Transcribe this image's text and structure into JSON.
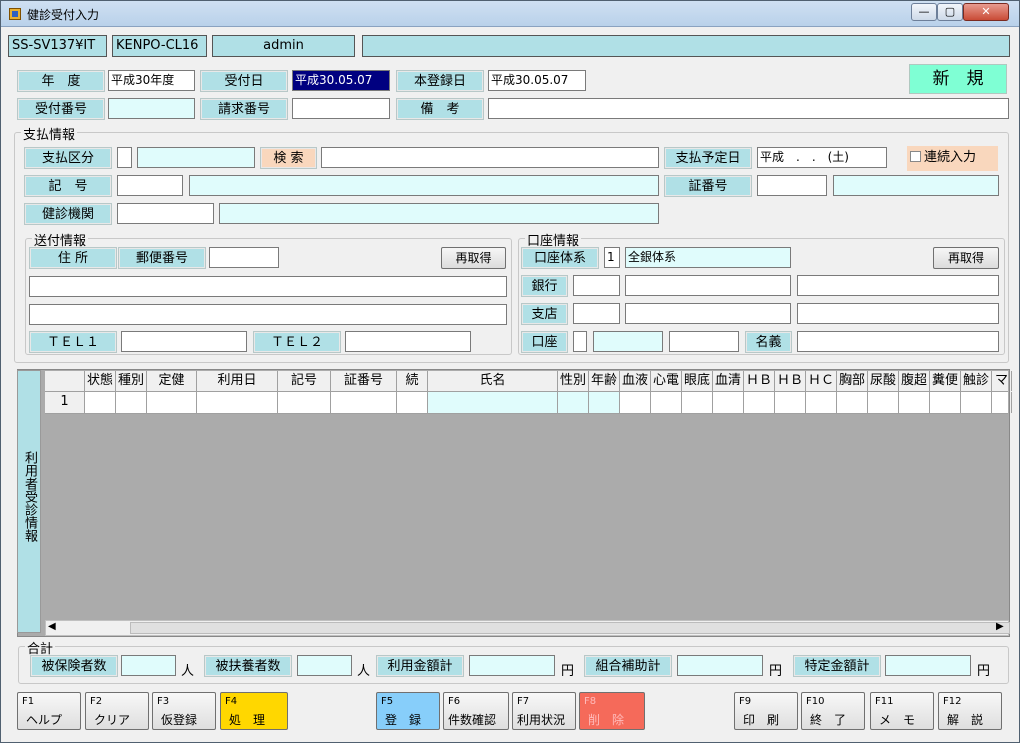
{
  "window": {
    "title": "健診受付入力",
    "min": "—",
    "max": "▢",
    "close": "✕"
  },
  "status": {
    "server": "SS-SV137¥IT",
    "client": "KENPO-CL16",
    "user": "admin"
  },
  "header": {
    "nendo_label": "年　度",
    "nendo_value": "平成30年度",
    "uketsukebi_label": "受付日",
    "uketsukebi_value": "平成30.05.07",
    "honnendo_label": "本登録日",
    "honnendo_value": "平成30.05.07",
    "new_label": "新　規",
    "uketsuke_no_label": "受付番号",
    "seikyu_no_label": "請求番号",
    "biko_label": "備　考"
  },
  "payment": {
    "title": "支払情報",
    "kubun_label": "支払区分",
    "search_label": "検 索",
    "yotei_label": "支払予定日",
    "yotei_value": "平成　.　.　(土)",
    "renzoku_label": "連続入力",
    "kigo_label": "記　号",
    "shoban_label": "証番号",
    "kikan_label": "健診機関"
  },
  "sofu": {
    "title": "送付情報",
    "jusho_label": "住 所",
    "yubin_label": "郵便番号",
    "reget": "再取得",
    "tel1": "ＴＥＬ１",
    "tel2": "ＴＥＬ２"
  },
  "koza": {
    "title": "口座情報",
    "taikei_label": "口座体系",
    "taikei_code": "1",
    "taikei_name": "全銀体系",
    "reget": "再取得",
    "ginko_label": "銀行",
    "shiten_label": "支店",
    "koza_label": "口座",
    "meigi_label": "名義"
  },
  "grid": {
    "side_label": "利用者受診情報",
    "columns": [
      "状態",
      "種別",
      "定健",
      "利用日",
      "記号",
      "証番号",
      "続",
      "氏名",
      "性別",
      "年齢",
      "血液",
      "心電",
      "眼底",
      "血清",
      "ＨＢ",
      "ＨＢ",
      "ＨＣ",
      "胸部",
      "尿酸",
      "腹超",
      "糞便",
      "触診",
      "マ"
    ],
    "rows": [
      {
        "no": "1"
      }
    ]
  },
  "totals": {
    "title": "合計",
    "hihoken_label": "被保険者数",
    "hifuyo_label": "被扶養者数",
    "riyo_label": "利用金額計",
    "kumiai_label": "組合補助計",
    "tokutei_label": "特定金額計",
    "unit_person": "人",
    "unit_yen": "円"
  },
  "fkeys": [
    {
      "key": "F1",
      "name": "ヘルプ"
    },
    {
      "key": "F2",
      "name": "クリア"
    },
    {
      "key": "F3",
      "name": "仮登録"
    },
    {
      "key": "F4",
      "name": "処　理"
    },
    {
      "key": "F5",
      "name": "登　録"
    },
    {
      "key": "F6",
      "name": "件数確認"
    },
    {
      "key": "F7",
      "name": "利用状況"
    },
    {
      "key": "F8",
      "name": "削　除"
    },
    {
      "key": "F9",
      "name": "印　刷"
    },
    {
      "key": "F10",
      "name": "終　了"
    },
    {
      "key": "F11",
      "name": "メ　モ"
    },
    {
      "key": "F12",
      "name": "解　説"
    }
  ],
  "colors": {
    "label_bg": "#b0e0e6",
    "new_bg": "#7fffd4",
    "f4_bg": "#ffd700",
    "f5_bg": "#87cefa",
    "f8_bg": "#f56a5a",
    "renzoku_bg": "#f9d7bd",
    "search_bg": "#f9d7bd"
  }
}
